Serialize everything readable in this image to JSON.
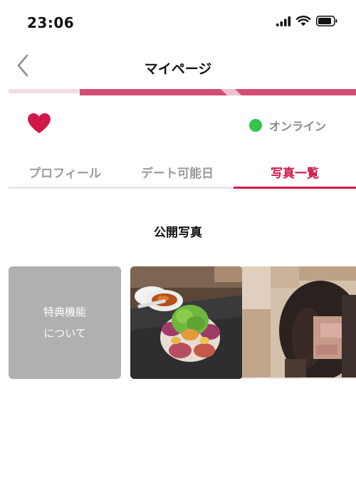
{
  "status_bar": {
    "time": "23:06"
  },
  "nav": {
    "title": "マイページ"
  },
  "profile": {
    "online_label": "オンライン"
  },
  "tabs": [
    {
      "label": "プロフィール",
      "active": false
    },
    {
      "label": "デート可能日",
      "active": false
    },
    {
      "label": "写真一覧",
      "active": true
    }
  ],
  "section": {
    "title": "公開写真"
  },
  "photos": {
    "special_label_line1": "特典機能",
    "special_label_line2": "について"
  },
  "colors": {
    "accent": "#d11849",
    "online": "#33c44c",
    "inactive_tab": "#9b9b9b",
    "tile_gray": "#b0b0b0"
  }
}
